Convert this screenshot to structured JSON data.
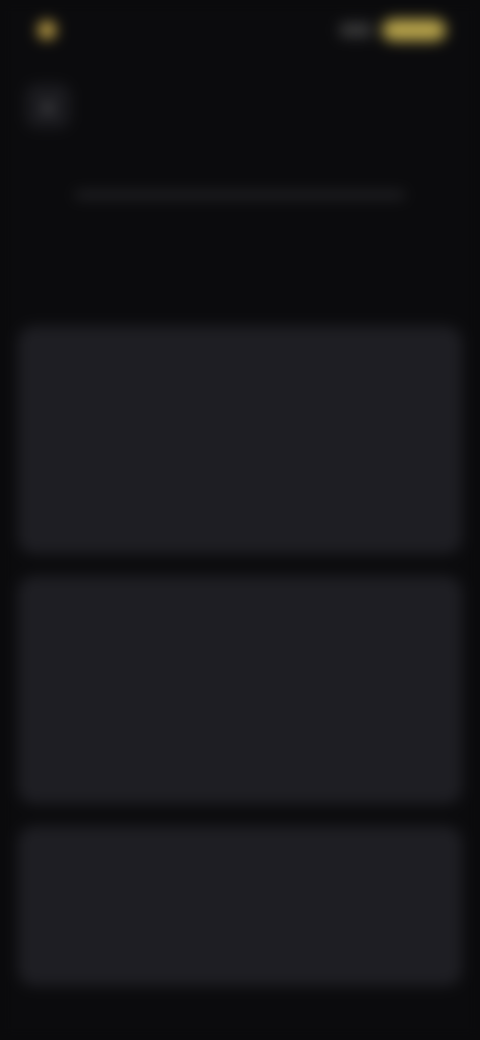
{
  "status_bar": {
    "time": "",
    "carrier": ""
  },
  "header": {
    "back_icon": "chevron-left-icon",
    "title": ""
  },
  "hero": {
    "line1": "",
    "line2": ""
  },
  "cards": [
    {
      "title": "",
      "body": "",
      "footer": ""
    },
    {
      "title": "",
      "body": "",
      "footer": ""
    },
    {
      "title": "",
      "body": "",
      "footer": ""
    }
  ],
  "colors": {
    "accent": "#8c86d6",
    "background": "#0b0b0d",
    "card": "#1e1e23",
    "status_accent": "#b6a24a"
  }
}
